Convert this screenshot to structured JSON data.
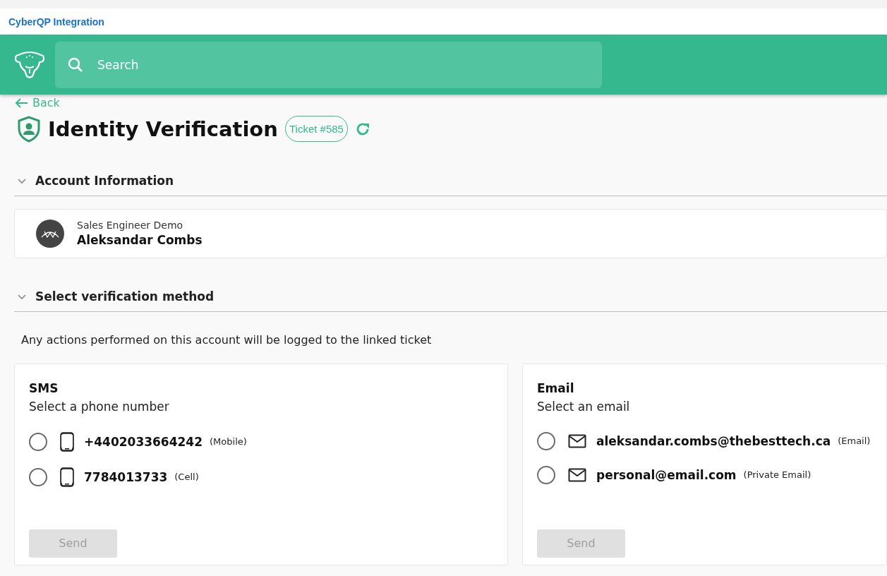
{
  "app_title": "CyberQP Integration",
  "search": {
    "placeholder": "Search"
  },
  "back_link": "Back",
  "page": {
    "title": "Identity Verification",
    "ticket": "Ticket #585"
  },
  "account_section": {
    "title": "Account Information",
    "expanded": true,
    "account": {
      "company": "Sales Engineer Demo",
      "name": "Aleksandar Combs"
    }
  },
  "verification_section": {
    "title": "Select verification method",
    "expanded": true,
    "notice": "Any actions performed on this account will be logged to the linked ticket",
    "methods": [
      {
        "kind": "phone",
        "title": "SMS",
        "subtitle": "Select a phone number",
        "options": [
          {
            "value": "+4402033664242",
            "type": "(Mobile)",
            "selected": false
          },
          {
            "value": "7784013733",
            "type": "(Cell)",
            "selected": false
          }
        ],
        "button": {
          "label": "Send",
          "disabled": true
        }
      },
      {
        "kind": "email",
        "title": "Email",
        "subtitle": "Select an email",
        "options": [
          {
            "value": "aleksandar.combs@thebesttech.ca",
            "type": "(Email)",
            "selected": false
          },
          {
            "value": "personal@email.com",
            "type": "(Private Email)",
            "selected": false
          }
        ],
        "button": {
          "label": "Send",
          "disabled": true
        }
      }
    ]
  }
}
